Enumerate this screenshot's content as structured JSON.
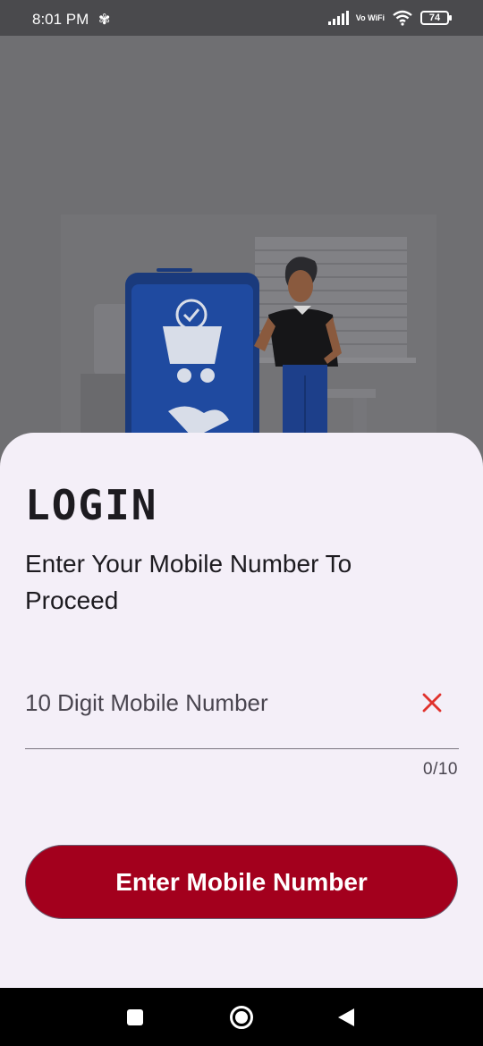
{
  "status_bar": {
    "time": "8:01 PM",
    "network_label": "Vo WiFi",
    "battery": "74"
  },
  "login": {
    "title": "LOGIN",
    "subtitle": "Enter Your Mobile Number To Proceed",
    "mobile_field": {
      "placeholder": "10 Digit Mobile Number",
      "value": "",
      "counter": "0/10"
    },
    "submit_label": "Enter Mobile Number"
  },
  "colors": {
    "primary": "#a3001d",
    "sheet_background": "#f4eff8",
    "clear_icon": "#e0322d",
    "scrim": "#6f6f72"
  },
  "icons": {
    "clear": "close-icon",
    "nav_recents": "square-icon",
    "nav_home": "circle-icon",
    "nav_back": "triangle-back-icon"
  }
}
